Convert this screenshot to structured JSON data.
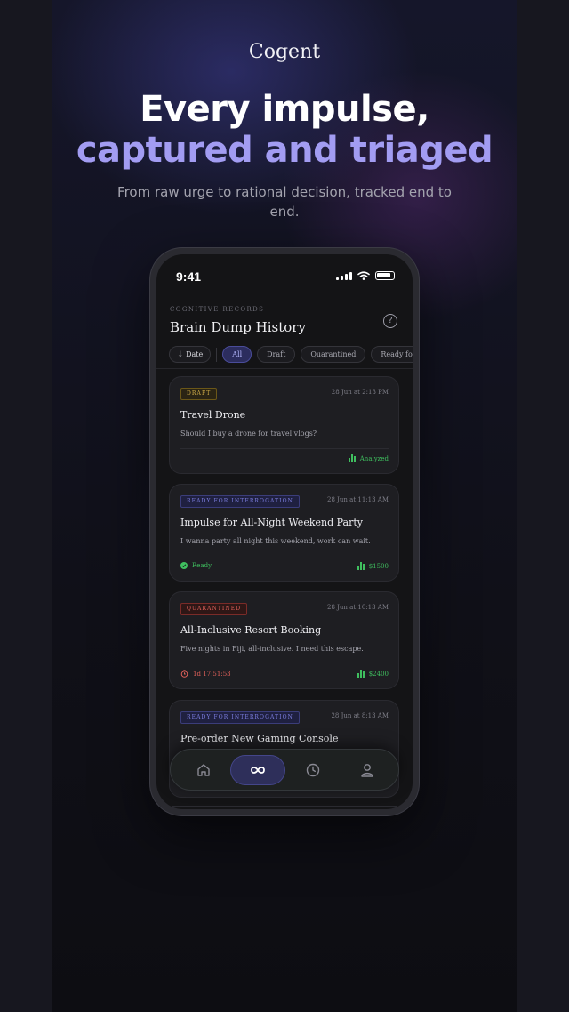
{
  "hero": {
    "brand": "Cogent",
    "headline_line1": "Every impulse,",
    "headline_line2": "captured and triaged",
    "subheadline": "From raw urge to rational decision, tracked end to end.",
    "accent_color": "#a29cf2"
  },
  "status_bar": {
    "time": "9:41",
    "icons": [
      "signal-icon",
      "wifi-icon",
      "battery-icon"
    ]
  },
  "header": {
    "eyebrow": "COGNITIVE RECORDS",
    "title": "Brain Dump History",
    "help_icon": "help-circle-icon"
  },
  "filters": {
    "sort_label": "Date",
    "sort_icon": "arrow-down-icon",
    "chips": [
      "All",
      "Draft",
      "Quarantined",
      "Ready for Inte"
    ],
    "active": "All"
  },
  "records": [
    {
      "badge": "DRAFT",
      "status": "draft",
      "date": "28 Jun at 2:13 PM",
      "title": "Travel Drone",
      "description": "Should I buy a drone for travel vlogs?",
      "footer_left": "",
      "footer_right": "Analyzed"
    },
    {
      "badge": "READY FOR INTERROGATION",
      "status": "ready",
      "date": "28 Jun at 11:13 AM",
      "title": "Impulse for All-Night Weekend Party",
      "description": "I wanna party all night this weekend, work can wait.",
      "footer_left": "Ready",
      "footer_right": "$1500"
    },
    {
      "badge": "QUARANTINED",
      "status": "quarantined",
      "date": "28 Jun at 10:13 AM",
      "title": "All-Inclusive Resort Booking",
      "description": "Five nights in Fiji, all-inclusive. I need this escape.",
      "footer_left": "1d 17:51:53",
      "footer_right": "$2400"
    },
    {
      "badge": "READY FOR INTERROGATION",
      "status": "ready",
      "date": "28 Jun at 8:13 AM",
      "title": "Pre-order New Gaming Console",
      "description": "",
      "footer_left": "",
      "footer_right": ""
    }
  ],
  "tabbar": {
    "tabs": [
      "home-icon",
      "infinity-icon",
      "clock-icon",
      "profile-icon"
    ],
    "active": "infinity-icon"
  },
  "colors": {
    "draft": "#d4b04a",
    "ready": "#7d7fe0",
    "quarantined": "#e0605a",
    "positive": "#3fbf5f"
  }
}
